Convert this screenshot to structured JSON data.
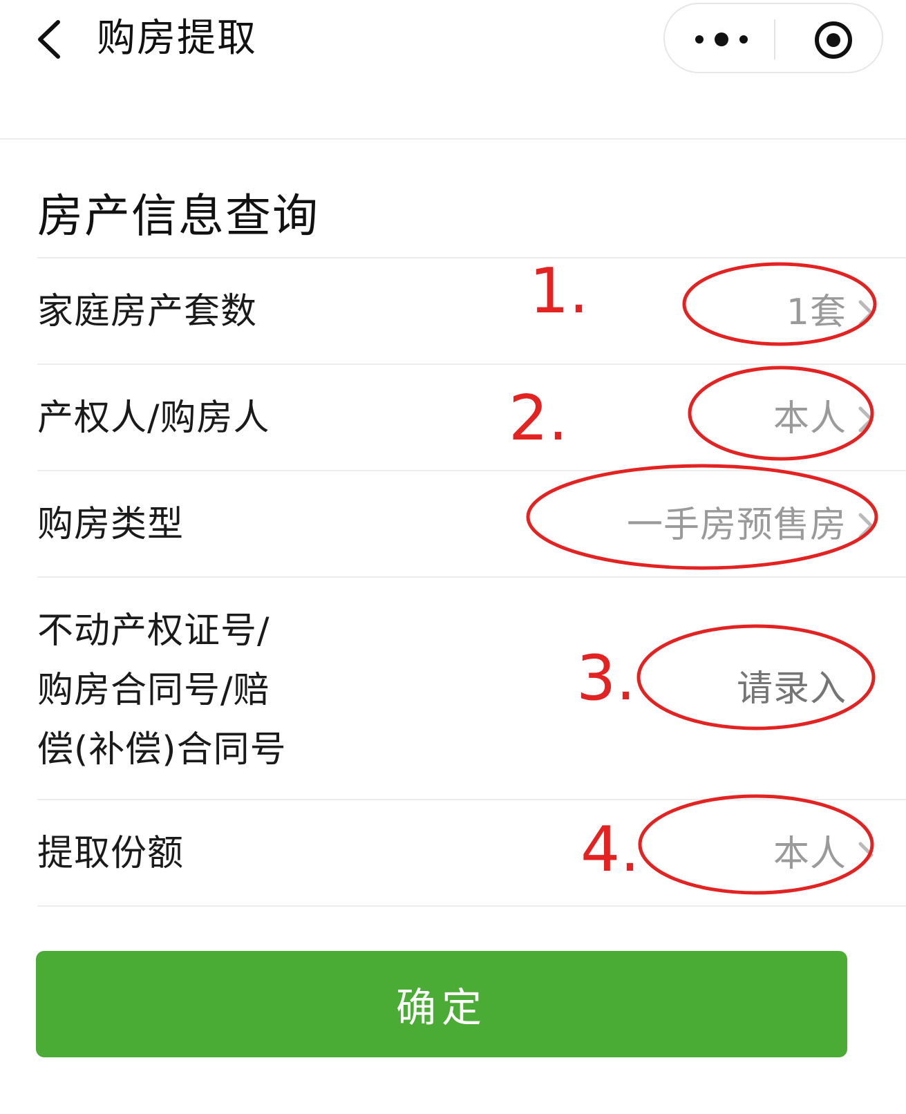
{
  "nav": {
    "title": "购房提取",
    "back_icon": "chevron-left-icon",
    "more_icon": "more-dots-icon",
    "close_icon": "target-close-icon"
  },
  "section": {
    "title": "房产信息查询"
  },
  "rows": [
    {
      "label": "家庭房产套数",
      "value": "1套",
      "has_arrow": true
    },
    {
      "label": "产权人/购房人",
      "value": "本人",
      "has_arrow": true
    },
    {
      "label": "购房类型",
      "value": "一手房预售房",
      "has_arrow": true
    },
    {
      "label": "不动产权证号/\n购房合同号/赔\n偿(补偿)合同号",
      "value": "请录入",
      "has_arrow": false
    },
    {
      "label": "提取份额",
      "value": "本人",
      "has_arrow": true
    }
  ],
  "annotations": {
    "color": "#e32222",
    "labels": [
      "1.",
      "2.",
      "3.",
      "4."
    ]
  },
  "confirm": {
    "label": "确定",
    "color": "#4aab35"
  }
}
